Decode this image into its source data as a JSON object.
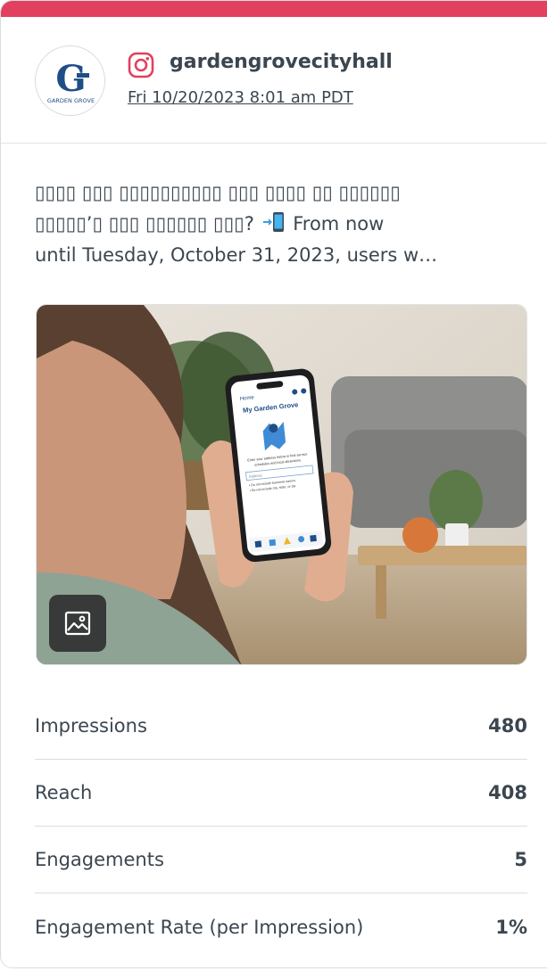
{
  "brand": {
    "accent": "#e3405f",
    "text": "#3b4650"
  },
  "profile": {
    "network": "instagram-icon",
    "handle": "gardengrovecityhall",
    "timestamp": "Fri 10/20/2023 8:01 am PDT",
    "avatar_text": "GARDEN GROVE",
    "avatar_monogram": "G"
  },
  "post": {
    "line1": "▯▯▯▯ ▯▯▯ ▯▯▯▯▯▯▯▯▯▯ ▯▯▯ ▯▯▯▯ ▯▯ ▯▯▯▯▯▯",
    "line2_a": "▯▯▯▯▯’▯ ▯▯▯ ▯▯▯▯▯▯ ▯▯▯?",
    "line2_b": "From now",
    "line3": "until Tuesday, October 31, 2023, users w…",
    "emoji": "mobile-phone-arrow-icon"
  },
  "media": {
    "phone_header": "Home",
    "phone_title": "My Garden Grove",
    "phone_desc_1": "Enter your address below to find service",
    "phone_desc_2": "schedules and local attractions.",
    "phone_input_placeholder": "Address",
    "phone_bullet_1": "• Do not include business names.",
    "phone_bullet_2": "• Do not include city, state, or zip.",
    "badge_icon": "image-icon"
  },
  "metrics": [
    {
      "label": "Impressions",
      "value": "480"
    },
    {
      "label": "Reach",
      "value": "408"
    },
    {
      "label": "Engagements",
      "value": "5"
    },
    {
      "label": "Engagement Rate (per Impression)",
      "value": "1%"
    }
  ]
}
